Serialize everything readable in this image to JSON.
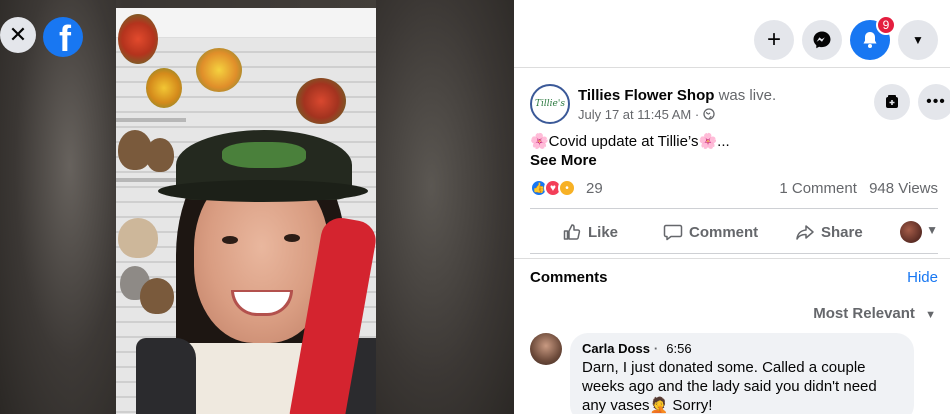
{
  "window": {
    "close_icon": "close-icon",
    "brand_icon": "facebook-logo-icon"
  },
  "topbar": {
    "create_icon": "plus-icon",
    "messenger_icon": "messenger-icon",
    "notifications_icon": "bell-icon",
    "notifications_count": "9",
    "account_icon": "caret-down-icon"
  },
  "post": {
    "page_name": "Tillies Flower Shop",
    "live_status": "was live.",
    "timestamp": "July 17 at 11:45 AM · ",
    "avatar_text": "Tillie's",
    "text": "🌸Covid update at Tillie’s🌸...",
    "see_more": "See More",
    "reaction_count": "29",
    "comment_count": "1 Comment",
    "view_count": "948 Views",
    "actions": {
      "like": "Like",
      "comment": "Comment",
      "share": "Share"
    }
  },
  "comments": {
    "title": "Comments",
    "hide": "Hide",
    "sort": "Most Relevant",
    "items": [
      {
        "author": "Carla Doss",
        "time": "6:56",
        "text": "Darn, I just donated some. Called a couple weeks ago and the lady said you didn't need any vases🤦 Sorry!"
      }
    ]
  },
  "colors": {
    "accent": "#1877f2",
    "badge": "#e41e3f",
    "secondary_text": "#65676b",
    "bubble": "#f0f2f5"
  }
}
